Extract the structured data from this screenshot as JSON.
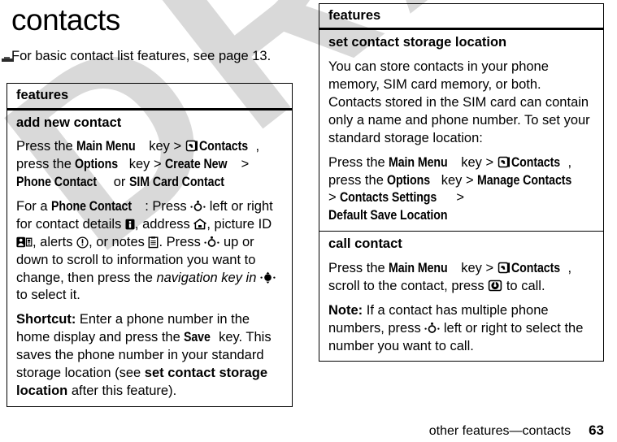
{
  "document": {
    "title": "contacts",
    "intro": "For basic contact list features, see page 13.",
    "footer": {
      "breadcrumb": "other features—contacts",
      "page_number": "63"
    },
    "watermark": "DRAFT",
    "watermark_color": "#d9d9d9"
  },
  "left_table": {
    "header": "features",
    "rows": [
      {
        "title": "add new contact",
        "paragraphs": [
          {
            "id": "p1",
            "parts": [
              {
                "type": "text",
                "text": "Press the "
              },
              {
                "type": "bold",
                "text": "Main Menu"
              },
              {
                "type": "text",
                "text": " key > "
              },
              {
                "type": "icon",
                "name": "contacts-icon"
              },
              {
                "type": "bold",
                "text": " Contacts"
              },
              {
                "type": "text",
                "text": ", press the "
              },
              {
                "type": "bold",
                "text": "Options"
              },
              {
                "type": "text",
                "text": " key > "
              },
              {
                "type": "bold",
                "text": "Create New"
              },
              {
                "type": "text",
                "text": " > "
              },
              {
                "type": "bold",
                "text": "Phone Contact"
              },
              {
                "type": "text",
                "text": " or "
              },
              {
                "type": "bold",
                "text": "SIM Card Contact"
              }
            ]
          },
          {
            "id": "p2",
            "parts": [
              {
                "type": "text",
                "text": "For a "
              },
              {
                "type": "bold",
                "text": "Phone Contact"
              },
              {
                "type": "text",
                "text": ": Press "
              },
              {
                "type": "icon",
                "name": "navigation-key-icon"
              },
              {
                "type": "text",
                "text": " left or right for contact details "
              },
              {
                "type": "icon",
                "name": "contact-details-icon"
              },
              {
                "type": "text",
                "text": ", address "
              },
              {
                "type": "icon",
                "name": "address-home-icon"
              },
              {
                "type": "text",
                "text": ", picture ID "
              },
              {
                "type": "icon",
                "name": "picture-id-icon"
              },
              {
                "type": "text",
                "text": ", alerts "
              },
              {
                "type": "icon",
                "name": "alerts-icon"
              },
              {
                "type": "text",
                "text": ", or notes "
              },
              {
                "type": "icon",
                "name": "notes-icon"
              },
              {
                "type": "text",
                "text": ". Press "
              },
              {
                "type": "icon",
                "name": "navigation-key-icon"
              },
              {
                "type": "text",
                "text": " up or down to scroll to information you want to change, then press the "
              },
              {
                "type": "italic",
                "text": "navigation key in"
              },
              {
                "type": "text",
                "text": " "
              },
              {
                "type": "icon",
                "name": "navigation-key-press-icon"
              },
              {
                "type": "text",
                "text": " to select it."
              }
            ]
          },
          {
            "id": "p3",
            "parts": [
              {
                "type": "boldplain",
                "text": "Shortcut:"
              },
              {
                "type": "text",
                "text": " Enter a phone number in the home display and press the "
              },
              {
                "type": "bold",
                "text": "Save"
              },
              {
                "type": "text",
                "text": " key. This saves the phone number in your standard storage location (see "
              },
              {
                "type": "boldplain",
                "text": "set contact storage location"
              },
              {
                "type": "text",
                "text": " after this feature)."
              }
            ]
          }
        ]
      }
    ]
  },
  "right_table": {
    "header": "features",
    "rows": [
      {
        "title": "set contact storage location",
        "paragraphs": [
          {
            "id": "r1p1",
            "parts": [
              {
                "type": "text",
                "text": "You can store contacts in your phone memory, SIM card memory, or both. Contacts stored in the SIM card can contain only a name and phone number. To set your standard storage location:"
              }
            ]
          },
          {
            "id": "r1p2",
            "parts": [
              {
                "type": "text",
                "text": "Press the "
              },
              {
                "type": "bold",
                "text": "Main Menu"
              },
              {
                "type": "text",
                "text": " key > "
              },
              {
                "type": "icon",
                "name": "contacts-icon"
              },
              {
                "type": "bold",
                "text": " Contacts"
              },
              {
                "type": "text",
                "text": ", press the "
              },
              {
                "type": "bold",
                "text": "Options"
              },
              {
                "type": "text",
                "text": " key > "
              },
              {
                "type": "bold",
                "text": "Manage Contacts"
              },
              {
                "type": "text",
                "text": " > "
              },
              {
                "type": "bold",
                "text": "Contacts Settings"
              },
              {
                "type": "text",
                "text": " > "
              },
              {
                "type": "bold",
                "text": "Default Save Location"
              }
            ]
          }
        ]
      },
      {
        "title": "call contact",
        "paragraphs": [
          {
            "id": "r2p1",
            "parts": [
              {
                "type": "text",
                "text": "Press the "
              },
              {
                "type": "bold",
                "text": "Main Menu"
              },
              {
                "type": "text",
                "text": " key > "
              },
              {
                "type": "icon",
                "name": "contacts-icon"
              },
              {
                "type": "bold",
                "text": " Contacts"
              },
              {
                "type": "text",
                "text": ", scroll to the contact, press "
              },
              {
                "type": "icon",
                "name": "send-call-key-icon"
              },
              {
                "type": "text",
                "text": " to call."
              }
            ]
          },
          {
            "id": "r2p2",
            "parts": [
              {
                "type": "boldplain",
                "text": "Note:"
              },
              {
                "type": "text",
                "text": " If a contact has multiple phone numbers, press "
              },
              {
                "type": "icon",
                "name": "navigation-key-icon"
              },
              {
                "type": "text",
                "text": " left or right to select the number you want to call."
              }
            ]
          }
        ]
      }
    ]
  }
}
